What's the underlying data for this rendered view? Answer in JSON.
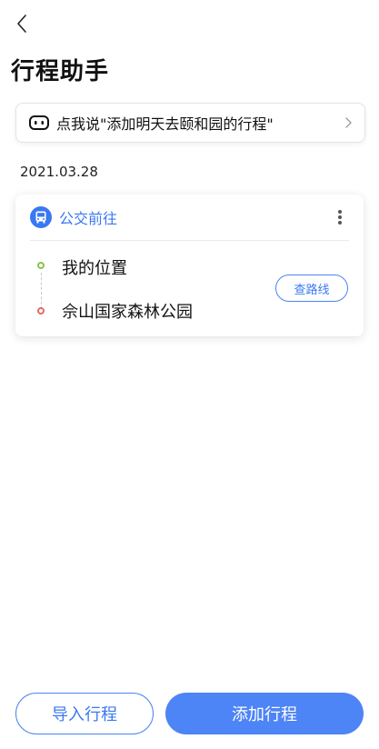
{
  "header": {
    "title": "行程助手"
  },
  "voice_prompt": {
    "text": "点我说\"添加明天去颐和园的行程\""
  },
  "trip": {
    "date": "2021.03.28",
    "transport_label": "公交前往",
    "from": "我的位置",
    "to": "佘山国家森林公园",
    "route_button": "查路线"
  },
  "footer": {
    "import_label": "导入行程",
    "add_label": "添加行程"
  },
  "colors": {
    "accent": "#3a78f2",
    "primary_button": "#4d84f6",
    "start_dot": "#8bc34a",
    "end_dot": "#e06c6c"
  }
}
